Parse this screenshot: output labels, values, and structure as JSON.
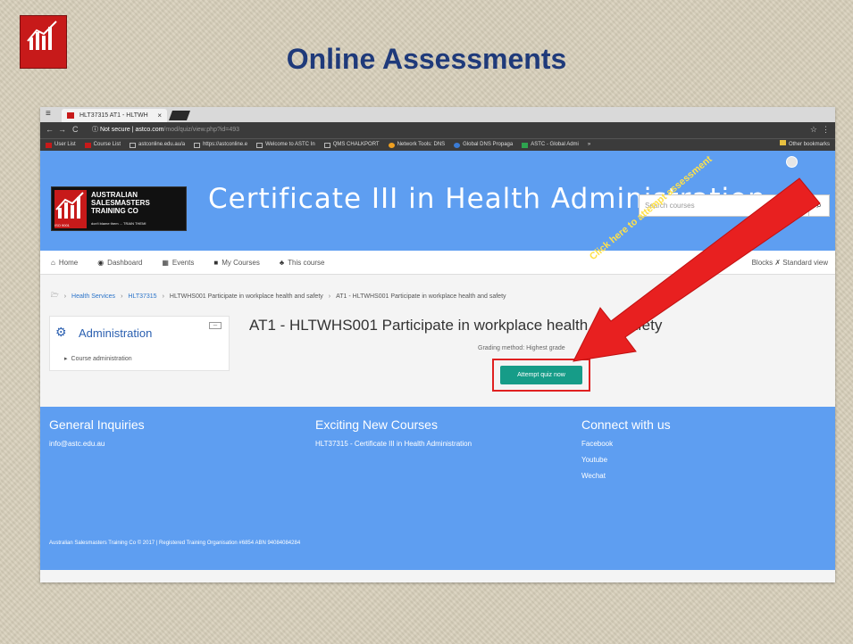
{
  "slide": {
    "title": "Online Assessments"
  },
  "browser": {
    "tab_label": "HLT37315 AT1 - HLTWH",
    "tab_close": "×",
    "url_secure": "ⓘ Not secure",
    "url_host": "astco.com",
    "url_path": "/mod/quiz/view.php?id=493",
    "bookmarks": [
      "User List",
      "Course List",
      "astconline.edu.au/a",
      "https://astconline.e",
      "Welcome to ASTC In",
      "QMS CHALKPORT",
      "Network Tools: DNS",
      "Global DNS Propaga",
      "ASTC - Global Admi"
    ],
    "bookmarks_more": "»",
    "bookmarks_other": "Other bookmarks"
  },
  "site": {
    "logo_name": "AUSTRALIAN SALESMASTERS TRAINING CO",
    "logo_tag": "don't blame them ... TRAIN THEM!",
    "logo_iso": "ISO 9001",
    "title": "Certificate III in Health Administration",
    "search_placeholder": "Search courses"
  },
  "nav": {
    "items": [
      {
        "icon": "home-icon",
        "glyph": "⌂",
        "label": "Home"
      },
      {
        "icon": "dashboard-icon",
        "glyph": "◉",
        "label": "Dashboard"
      },
      {
        "icon": "calendar-icon",
        "glyph": "▦",
        "label": "Events"
      },
      {
        "icon": "briefcase-icon",
        "glyph": "■",
        "label": "My Courses"
      },
      {
        "icon": "sitemap-icon",
        "glyph": "♣",
        "label": "This course"
      }
    ],
    "right": "Blocks ✗ Standard view"
  },
  "breadcrumb": {
    "items": [
      "Health Services",
      "HLT37315",
      "HLTWHS001 Participate in workplace health and safety",
      "AT1 - HLTWHS001 Participate in workplace health and safety"
    ],
    "separator": "›"
  },
  "admin_block": {
    "title": "Administration",
    "link": "Course administration"
  },
  "quiz": {
    "title": "AT1 - HLTWHS001 Participate in workplace health and safety",
    "grading": "Grading method: Highest grade",
    "attempt_button": "Attempt quiz now"
  },
  "footer": {
    "col1_title": "General Inquiries",
    "col1_email": "info@astc.edu.au",
    "col2_title": "Exciting New Courses",
    "col2_course": "HLT37315 - Certificate III in Health Administration",
    "col3_title": "Connect with us",
    "col3_links": [
      "Facebook",
      "Youtube",
      "Wechat"
    ],
    "copyright": "Australian Salesmasters Training Co © 2017 | Registered Training Organisation #6854 ABN 94084084284"
  },
  "annotation": {
    "text": "Click here to attempt assessment",
    "color": "#e82020"
  }
}
